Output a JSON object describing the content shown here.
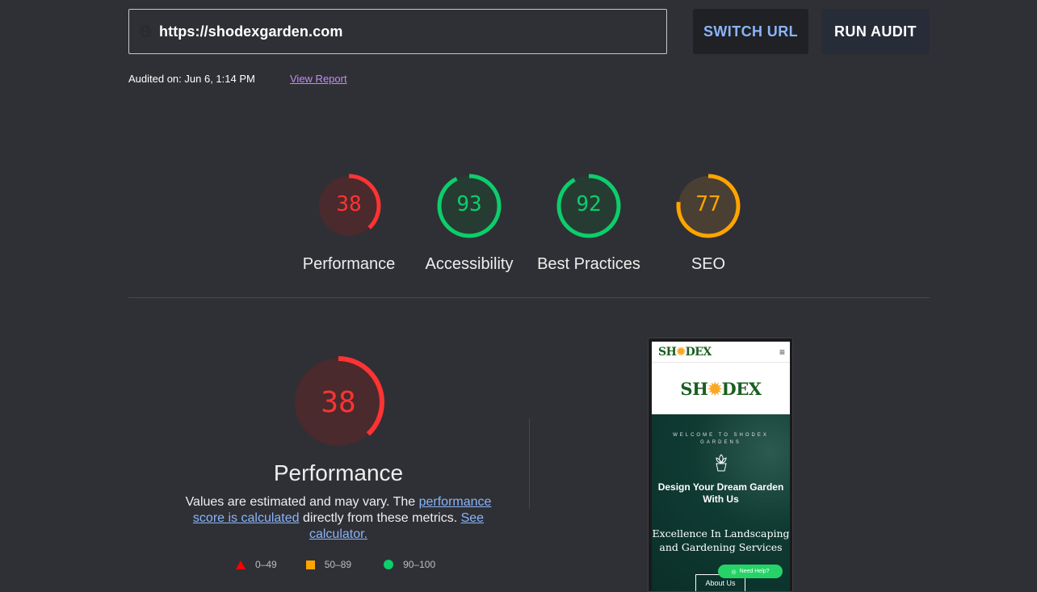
{
  "url_bar": {
    "url": "https://shodexgarden.com",
    "switch_label": "SWITCH URL",
    "run_label": "RUN AUDIT"
  },
  "audit_info": {
    "audited_on": "Audited on: Jun 6, 1:14 PM",
    "view_report": "View Report"
  },
  "gauges": [
    {
      "label": "Performance",
      "score": "38",
      "value": 38,
      "color": "#ff3333",
      "bg": "#4a2a2c"
    },
    {
      "label": "Accessibility",
      "score": "93",
      "value": 93,
      "color": "#0cce6b",
      "bg": "#263c33"
    },
    {
      "label": "Best Practices",
      "score": "92",
      "value": 92,
      "color": "#0cce6b",
      "bg": "#263c33"
    },
    {
      "label": "SEO",
      "score": "77",
      "value": 77,
      "color": "#ffa400",
      "bg": "#4a3f33"
    }
  ],
  "performance": {
    "score": "38",
    "value": 38,
    "title": "Performance",
    "desc_prefix": "Values are estimated and may vary. The ",
    "desc_link1": "performance score is calculated",
    "desc_middle": " directly from these metrics. ",
    "desc_link2": "See calculator."
  },
  "legend": {
    "fail": "0–49",
    "average": "50–89",
    "pass": "90–100"
  },
  "colors": {
    "fail": "#ff3333",
    "average": "#ffa400",
    "pass": "#0cce6b",
    "link": "#8ab4f8"
  },
  "thumbnail": {
    "logo_small": [
      "SH",
      "✹",
      "DEX"
    ],
    "logo_big": [
      "SH",
      "✹",
      "DEX"
    ],
    "menu_icon": "≡",
    "welcome": "WELCOME TO SHODEX GARDENS",
    "dream": "Design Your Dream Garden With Us",
    "excellence": "Excellence In Landscaping and Gardening Services",
    "help": "Need Help?",
    "about": "About Us"
  }
}
